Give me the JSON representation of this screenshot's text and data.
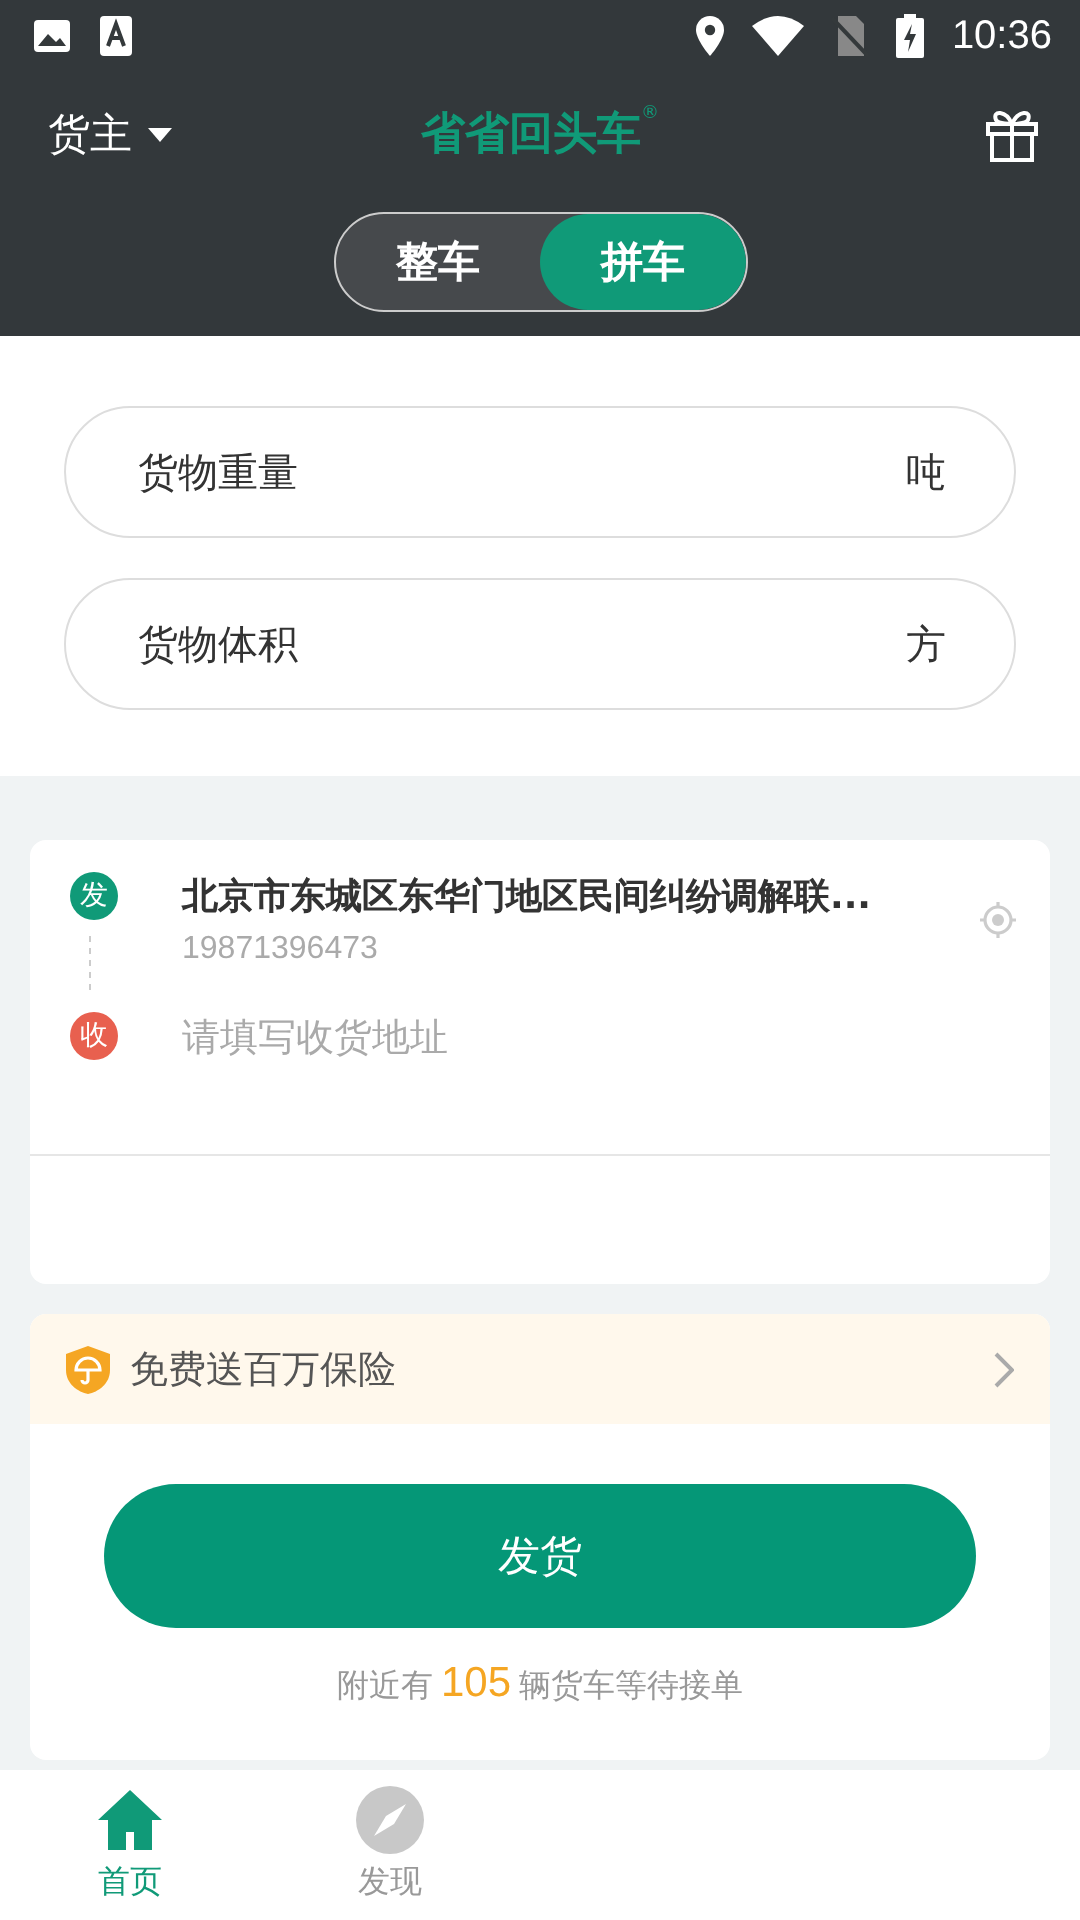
{
  "status_bar": {
    "time": "10:36"
  },
  "header": {
    "role": "货主",
    "logo": "省省回头车",
    "logo_mark": "®"
  },
  "tabs": [
    {
      "label": "整车",
      "selected": false
    },
    {
      "label": "拼车",
      "selected": true
    }
  ],
  "cargo_fields": [
    {
      "placeholder": "货物重量",
      "unit": "吨"
    },
    {
      "placeholder": "货物体积",
      "unit": "方"
    }
  ],
  "route": [
    {
      "badge": "发",
      "color": "#109a78",
      "address": "北京市东城区东华门地区民间纠纷调解联...",
      "phone": "19871396473"
    },
    {
      "badge": "收",
      "color": "#e8604f",
      "placeholder": "请填写收货地址"
    }
  ],
  "insurance": {
    "label": "免费送百万保险"
  },
  "ship_button": "发货",
  "nearby": {
    "prefix": "附近有",
    "count": "105",
    "suffix": "辆货车等待接单"
  },
  "bottom_nav": [
    {
      "label": "首页",
      "kind": "home",
      "selected": true
    },
    {
      "label": "发现",
      "kind": "discover",
      "selected": false
    }
  ]
}
